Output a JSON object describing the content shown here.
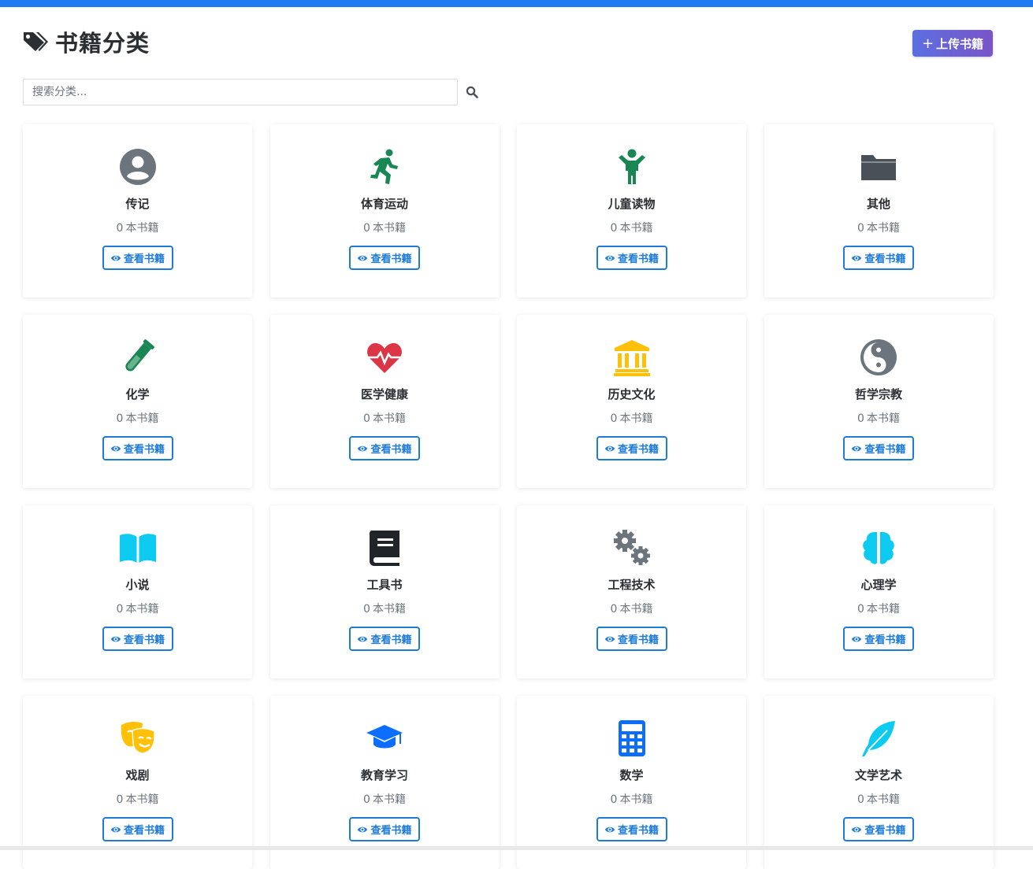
{
  "header": {
    "title": "书籍分类",
    "upload_label": "上传书籍",
    "upload_plus": "+"
  },
  "search": {
    "placeholder": "搜索分类..."
  },
  "view_label": "查看书籍",
  "count_suffix": "本书籍",
  "categories": [
    {
      "name": "传记",
      "count": "0",
      "icon": "user-circle-icon",
      "color": "#6c757d"
    },
    {
      "name": "体育运动",
      "count": "0",
      "icon": "running-icon",
      "color": "#198754"
    },
    {
      "name": "儿童读物",
      "count": "0",
      "icon": "child-icon",
      "color": "#198754"
    },
    {
      "name": "其他",
      "count": "0",
      "icon": "folder-icon",
      "color": "#495057"
    },
    {
      "name": "化学",
      "count": "0",
      "icon": "flask-icon",
      "color": "#198754"
    },
    {
      "name": "医学健康",
      "count": "0",
      "icon": "heartbeat-icon",
      "color": "#dc3545"
    },
    {
      "name": "历史文化",
      "count": "0",
      "icon": "landmark-icon",
      "color": "#ffc107"
    },
    {
      "name": "哲学宗教",
      "count": "0",
      "icon": "yin-yang-icon",
      "color": "#6c757d"
    },
    {
      "name": "小说",
      "count": "0",
      "icon": "book-open-icon",
      "color": "#0dcaf0"
    },
    {
      "name": "工具书",
      "count": "0",
      "icon": "book-icon",
      "color": "#212529"
    },
    {
      "name": "工程技术",
      "count": "0",
      "icon": "cogs-icon",
      "color": "#6c757d"
    },
    {
      "name": "心理学",
      "count": "0",
      "icon": "brain-icon",
      "color": "#0dcaf0"
    },
    {
      "name": "戏剧",
      "count": "0",
      "icon": "theater-masks-icon",
      "color": "#ffc107"
    },
    {
      "name": "教育学习",
      "count": "0",
      "icon": "graduation-cap-icon",
      "color": "#0d6efd"
    },
    {
      "name": "数学",
      "count": "0",
      "icon": "calculator-icon",
      "color": "#0d6efd"
    },
    {
      "name": "文学艺术",
      "count": "0",
      "icon": "feather-icon",
      "color": "#0dcaf0"
    }
  ],
  "colors": {
    "accent": "#1f7bd8",
    "topbar": "#1f7bf2",
    "upload_gradient_start": "#5b6fe0",
    "upload_gradient_end": "#7a55c8"
  }
}
